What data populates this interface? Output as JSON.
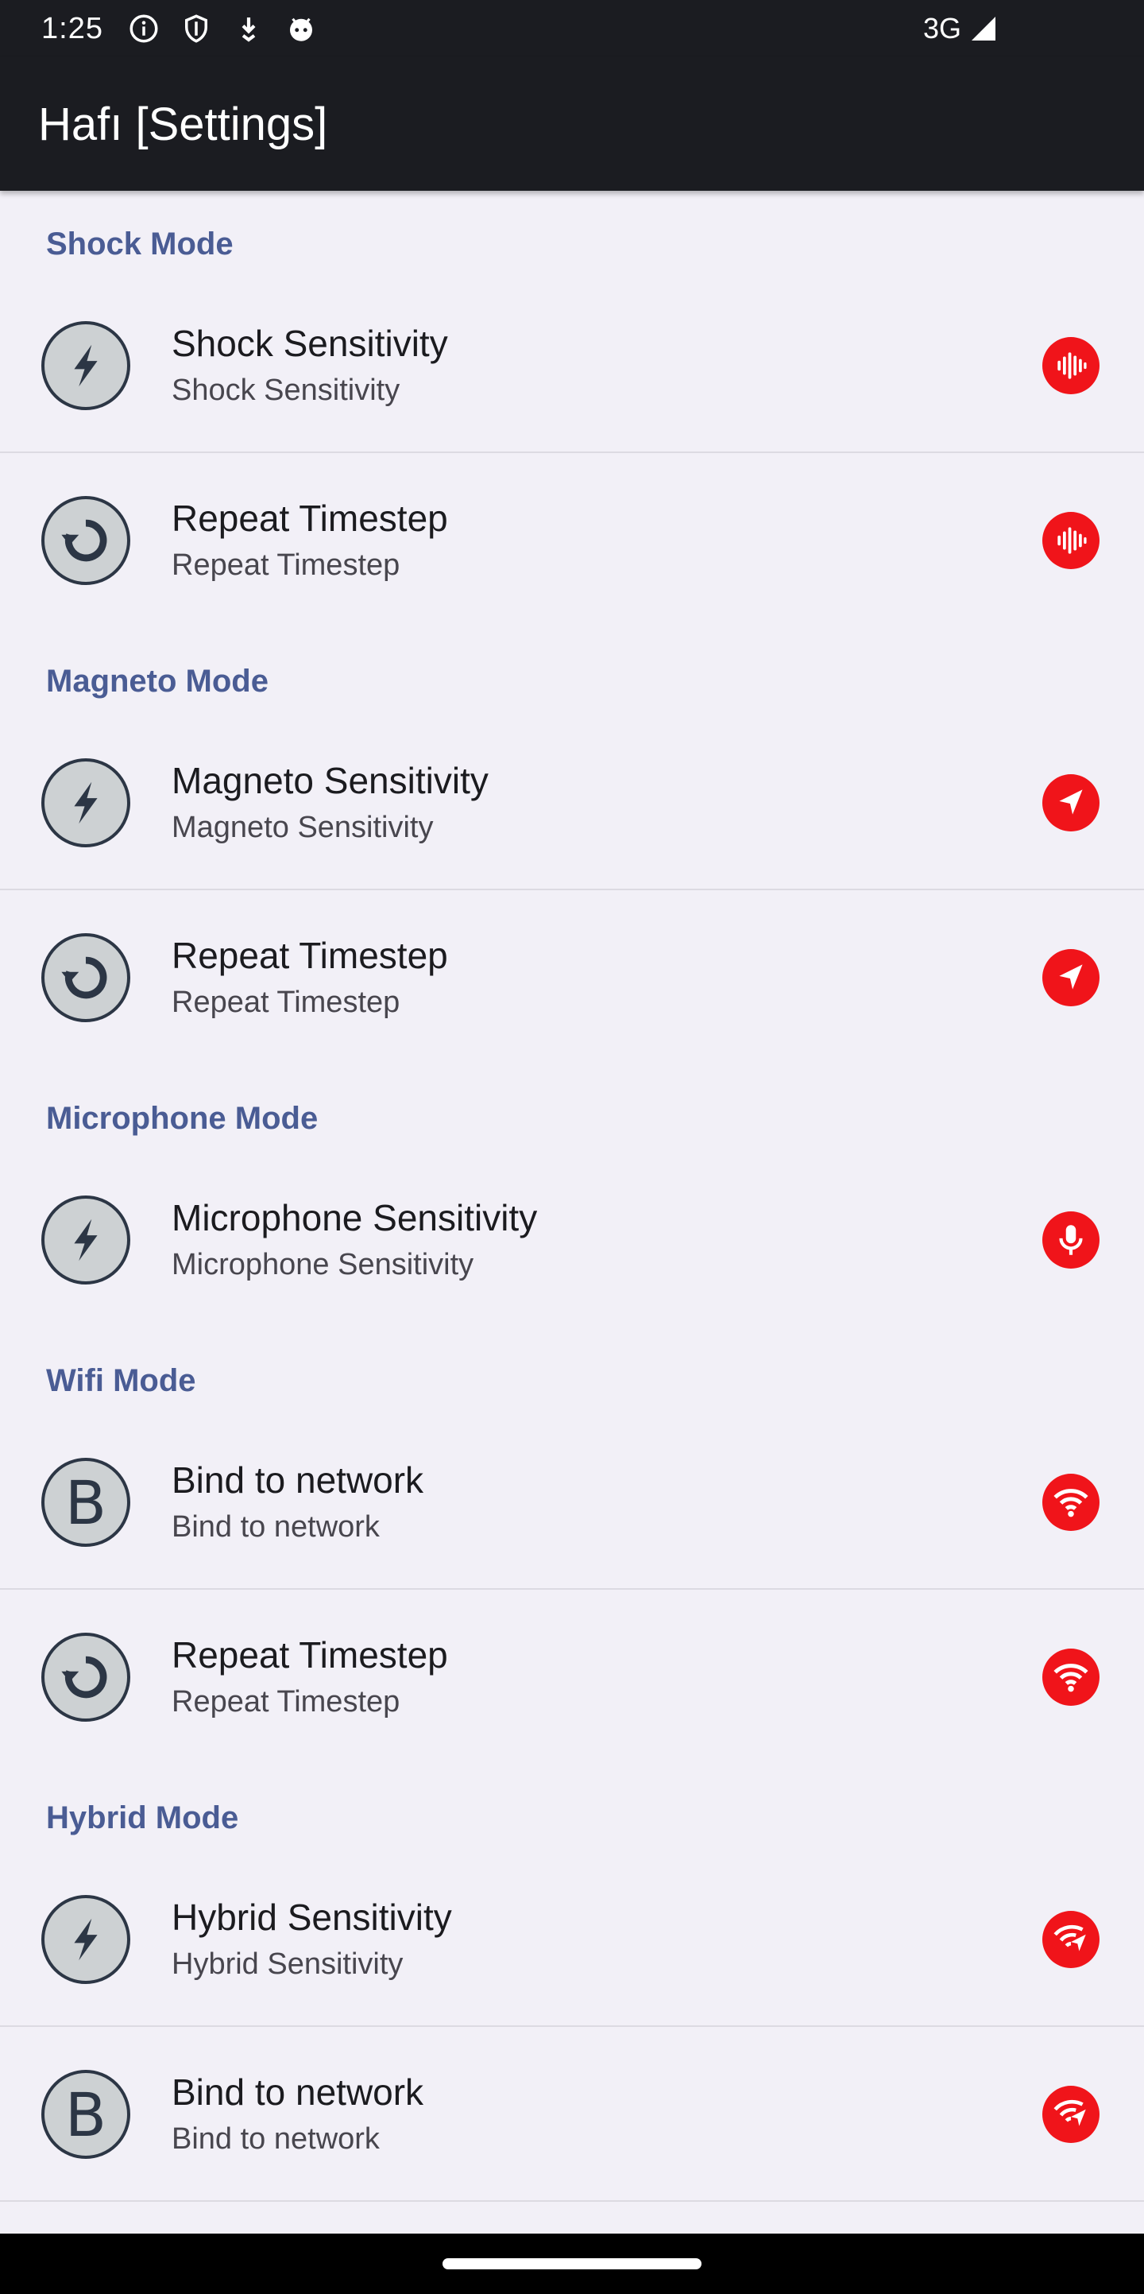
{
  "status_bar": {
    "time": "1:25",
    "network": "3G",
    "icons": [
      "info-icon",
      "shield-icon",
      "download-icon",
      "android-face-icon",
      "signal-icon"
    ]
  },
  "app_bar": {
    "title": "Hafı [Settings]"
  },
  "colors": {
    "accent": "#4a5c94",
    "badge": "#f0141a",
    "bar": "#1b1c21",
    "background": "#f2f0f7"
  },
  "sections": [
    {
      "header": "Shock Mode",
      "items": [
        {
          "title": "Shock Sensitivity",
          "subtitle": "Shock Sensitivity",
          "icon": "bolt-icon",
          "badge": "vibration-icon"
        },
        {
          "title": "Repeat Timestep",
          "subtitle": "Repeat Timestep",
          "icon": "repeat-icon",
          "badge": "vibration-icon"
        }
      ]
    },
    {
      "header": "Magneto Mode",
      "items": [
        {
          "title": "Magneto Sensitivity",
          "subtitle": "Magneto Sensitivity",
          "icon": "bolt-icon",
          "badge": "navigation-icon"
        },
        {
          "title": "Repeat Timestep",
          "subtitle": "Repeat Timestep",
          "icon": "repeat-icon",
          "badge": "navigation-icon"
        }
      ]
    },
    {
      "header": "Microphone Mode",
      "items": [
        {
          "title": "Microphone Sensitivity",
          "subtitle": "Microphone Sensitivity",
          "icon": "bolt-icon",
          "badge": "microphone-icon"
        }
      ]
    },
    {
      "header": "Wifi Mode",
      "items": [
        {
          "title": "Bind to network",
          "subtitle": "Bind to network",
          "icon": "letter-b-icon",
          "icon_letter": "B",
          "badge": "wifi-icon"
        },
        {
          "title": "Repeat Timestep",
          "subtitle": "Repeat Timestep",
          "icon": "repeat-icon",
          "badge": "wifi-icon"
        }
      ]
    },
    {
      "header": "Hybrid Mode",
      "items": [
        {
          "title": "Hybrid Sensitivity",
          "subtitle": "Hybrid Sensitivity",
          "icon": "bolt-icon",
          "badge": "wifi-navigation-icon"
        },
        {
          "title": "Bind to network",
          "subtitle": "Bind to network",
          "icon": "letter-b-icon",
          "icon_letter": "B",
          "badge": "wifi-navigation-icon"
        }
      ]
    }
  ]
}
